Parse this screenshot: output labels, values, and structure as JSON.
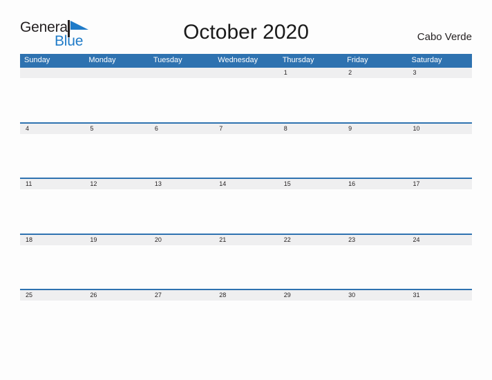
{
  "brand": {
    "name_part1": "General",
    "name_part2": "Blue",
    "accent_color": "#1f7bc8",
    "flag_icon": "flag-triangle-icon"
  },
  "header": {
    "title": "October 2020",
    "location": "Cabo Verde"
  },
  "calendar": {
    "month": "October",
    "year": "2020",
    "header_color": "#2e72b0",
    "date_strip_color": "#efeff0",
    "weekdays": [
      "Sunday",
      "Monday",
      "Tuesday",
      "Wednesday",
      "Thursday",
      "Friday",
      "Saturday"
    ],
    "weeks": [
      [
        "",
        "",
        "",
        "",
        "1",
        "2",
        "3"
      ],
      [
        "4",
        "5",
        "6",
        "7",
        "8",
        "9",
        "10"
      ],
      [
        "11",
        "12",
        "13",
        "14",
        "15",
        "16",
        "17"
      ],
      [
        "18",
        "19",
        "20",
        "21",
        "22",
        "23",
        "24"
      ],
      [
        "25",
        "26",
        "27",
        "28",
        "29",
        "30",
        "31"
      ]
    ]
  }
}
